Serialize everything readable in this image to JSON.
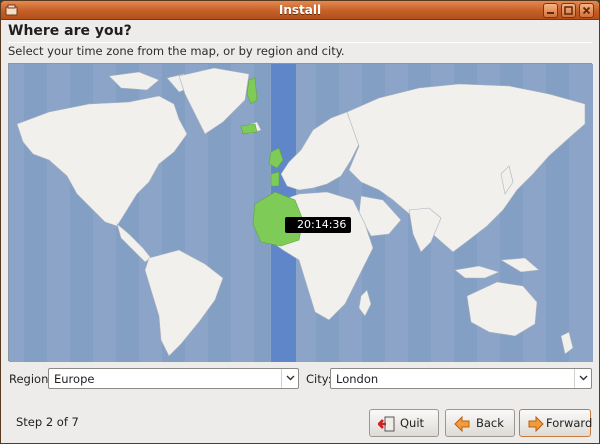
{
  "window": {
    "title": "Install"
  },
  "page": {
    "heading": "Where are you?",
    "instruction": "Select your time zone from the map, or by region and city."
  },
  "map": {
    "time_readout": "20:14:36"
  },
  "region": {
    "label": "Region:",
    "value": "Europe"
  },
  "city": {
    "label": "City:",
    "value": "London"
  },
  "footer": {
    "step_text": "Step 2 of 7"
  },
  "buttons": {
    "quit": "Quit",
    "back": "Back",
    "forward": "Forward"
  },
  "colors": {
    "titlebar": "#c45f26",
    "ocean": "#8ba4c8",
    "land": "#f1f0ec",
    "timezone_band": "#5f86c8",
    "selected_zone": "#7fcb58"
  },
  "icons": {
    "window_min": "minimize-icon",
    "window_max": "maximize-icon",
    "window_close": "close-icon",
    "quit": "exit-door-icon",
    "back": "arrow-left-icon",
    "forward": "arrow-right-icon"
  }
}
